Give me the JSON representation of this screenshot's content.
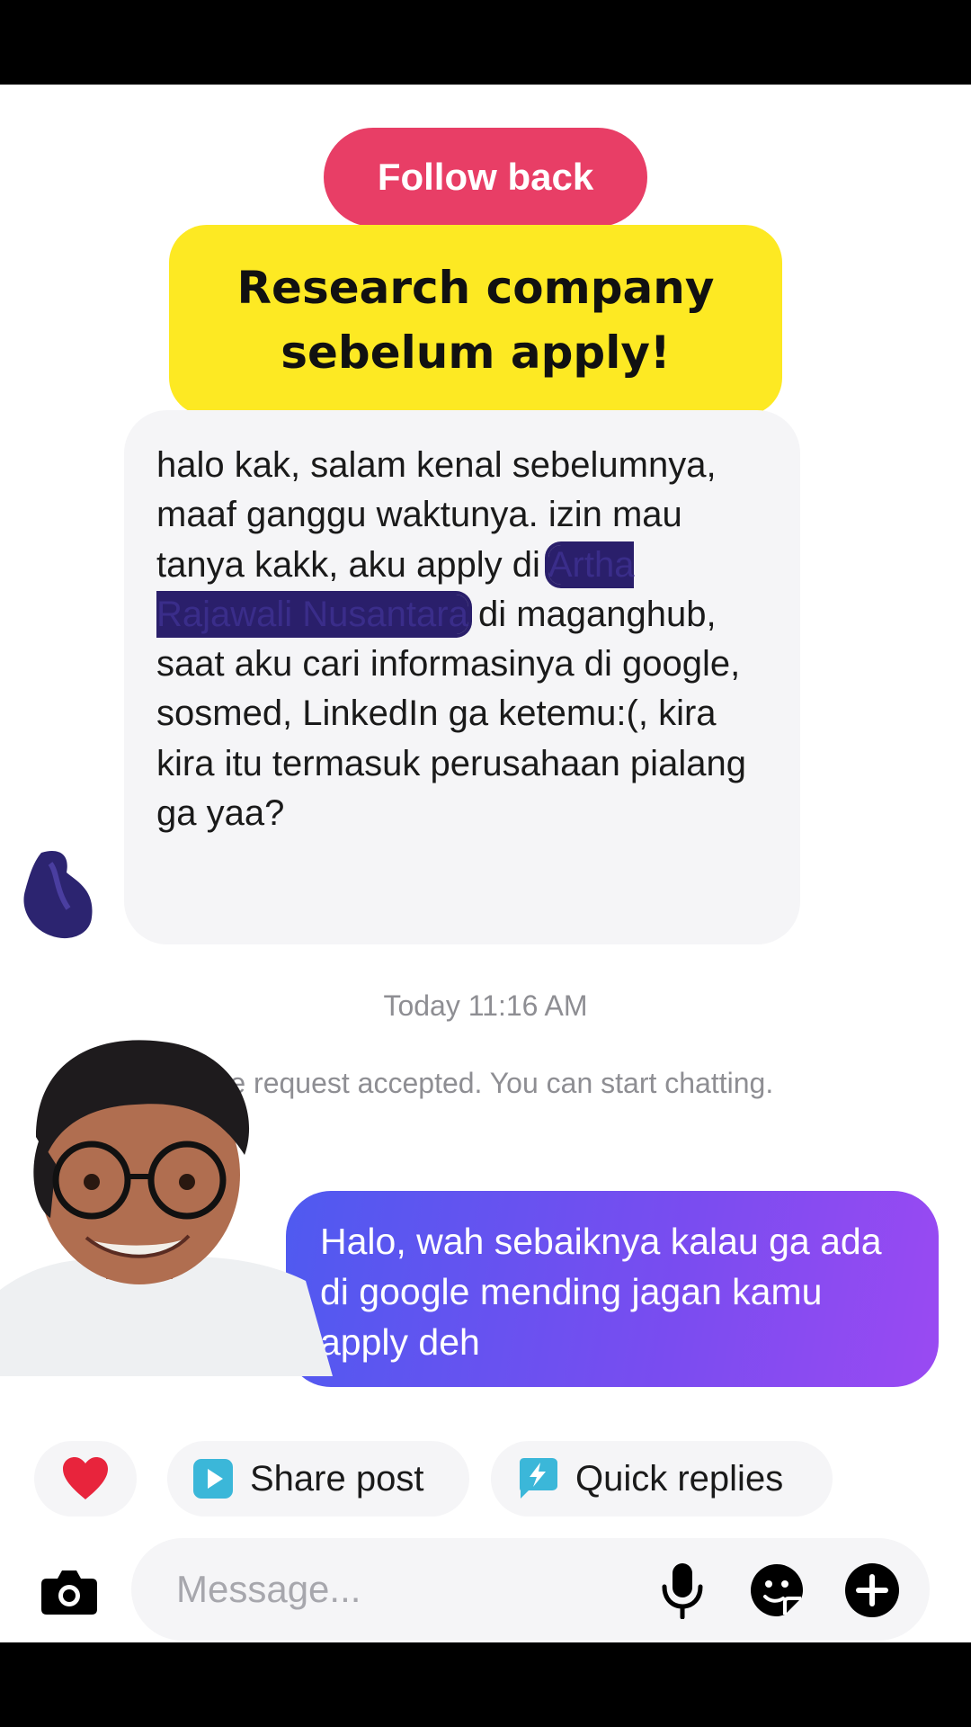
{
  "header": {
    "follow_back_label": "Follow back"
  },
  "overlay_caption": {
    "line1": "Research company",
    "line2": "sebelum apply!"
  },
  "incoming_message": {
    "text_before": "halo kak, salam kenal sebelumnya, maaf ganggu waktunya. izin mau tanya kakk, aku apply di ",
    "redacted_text": "Artha Rajawali Nusantara",
    "text_after": " di maganghub, saat aku cari informasinya di google, sosmed, LinkedIn ga ketemu:(, kira kira itu termasuk perusahaan pialang ga yaa?"
  },
  "timestamp": "Today 11:16 AM",
  "system_message": "age request accepted. You can start chatting.",
  "outgoing_message": {
    "text": "Halo, wah sebaiknya kalau ga ada di google mending jagan kamu apply deh"
  },
  "quick_actions": {
    "heart_icon": "heart-icon",
    "share_post_label": "Share post",
    "share_post_icon": "play-square-icon",
    "quick_replies_label": "Quick replies",
    "quick_replies_icon": "lightning-bubble-icon"
  },
  "composer": {
    "placeholder": "Message...",
    "camera_icon": "camera-icon",
    "mic_icon": "microphone-icon",
    "sticker_icon": "sticker-icon",
    "plus_icon": "plus-circle-icon"
  },
  "colors": {
    "follow_back_bg": "#e83e66",
    "caption_bg": "#fde923",
    "outgoing_gradient_start": "#4f5af0",
    "outgoing_gradient_end": "#9a4af2",
    "incoming_bg": "#f5f5f7",
    "share_icon_color": "#3bb7d9"
  }
}
